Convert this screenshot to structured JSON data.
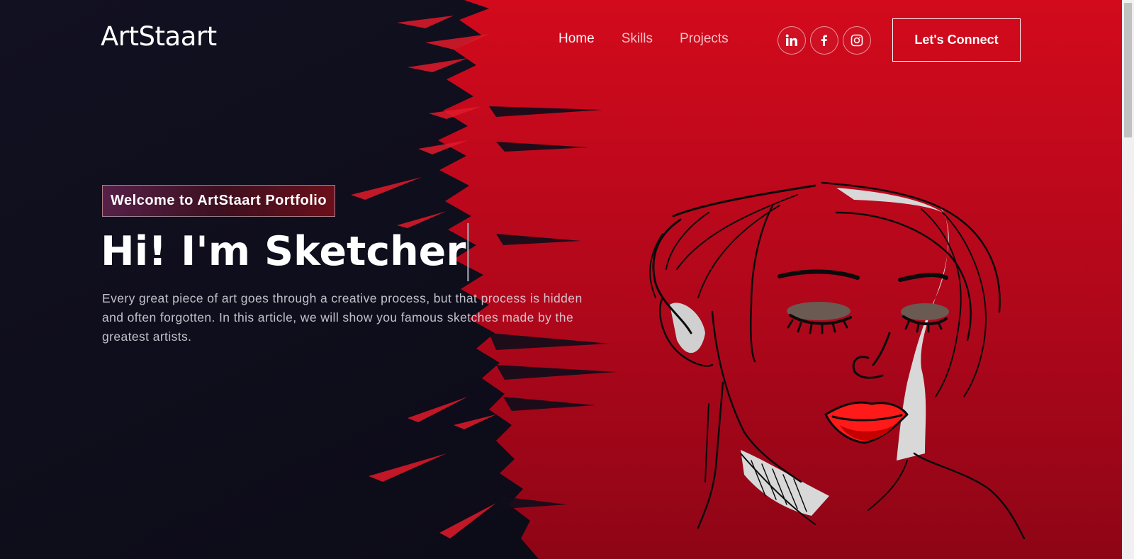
{
  "header": {
    "brand": "ArtStaart",
    "nav": [
      {
        "label": "Home"
      },
      {
        "label": "Skills"
      },
      {
        "label": "Projects"
      }
    ],
    "socials": [
      {
        "icon": "linkedin-icon"
      },
      {
        "icon": "facebook-icon"
      },
      {
        "icon": "instagram-icon"
      }
    ],
    "connect_label": "Let's Connect"
  },
  "hero": {
    "tagline": "Welcome to ArtStaart Portfolio",
    "headline": "Hi! I'm Sketcher",
    "description": "Every great piece of art goes through a creative process, but that process is hidden and often forgotten. In this article, we will show you famous sketches made by the greatest artists.",
    "illustration": "sketch-woman-portrait"
  },
  "colors": {
    "dark_bg": "#0e0d1a",
    "brand_red": "#c0061c",
    "lip_red": "#ff1a1a"
  }
}
